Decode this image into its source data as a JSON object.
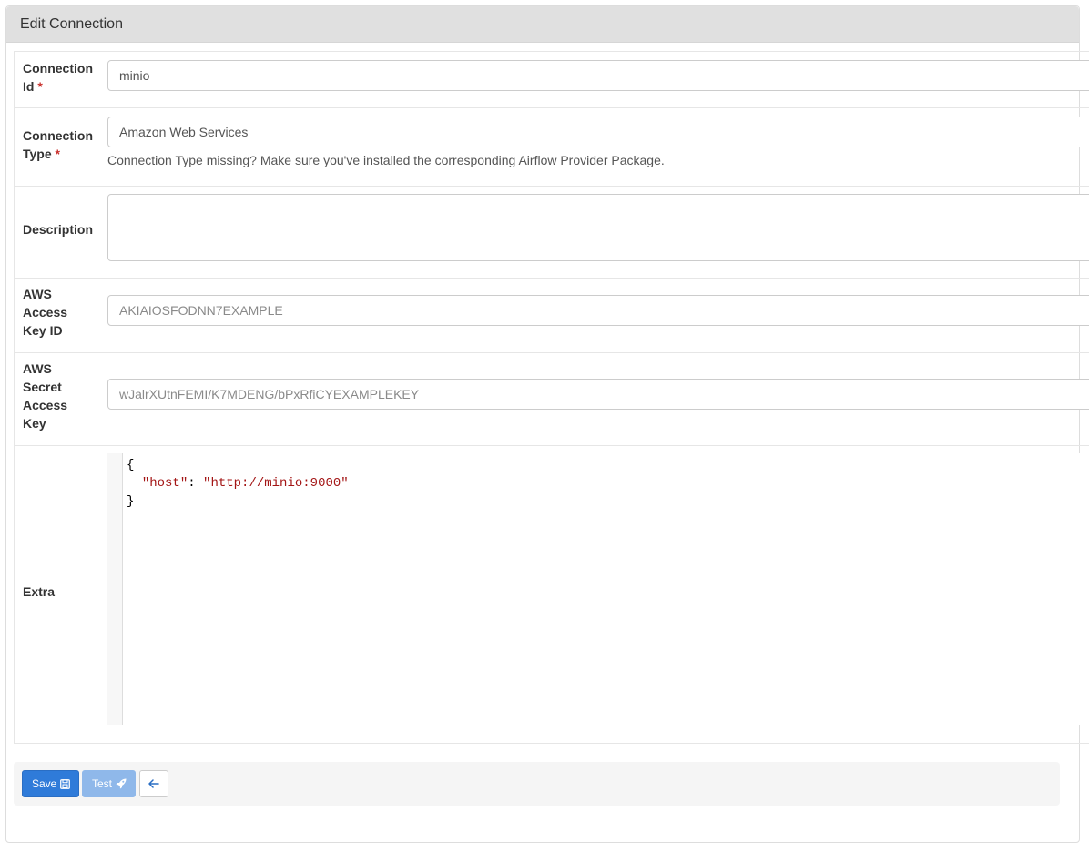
{
  "panel": {
    "title": "Edit Connection"
  },
  "fields": {
    "conn_id": {
      "label_line1": "Connection",
      "label_line2": "Id",
      "required_mark": "*",
      "value": "minio"
    },
    "conn_type": {
      "label_line1": "Connection",
      "label_line2": "Type",
      "required_mark": "*",
      "value": "Amazon Web Services",
      "help": "Connection Type missing? Make sure you've installed the corresponding Airflow Provider Package."
    },
    "description": {
      "label": "Description",
      "value": ""
    },
    "aws_access_key_id": {
      "label_line1": "AWS",
      "label_line2": "Access",
      "label_line3": "Key ID",
      "placeholder": "AKIAIOSFODNN7EXAMPLE"
    },
    "aws_secret_access_key": {
      "label_line1": "AWS",
      "label_line2": "Secret",
      "label_line3": "Access",
      "label_line4": "Key",
      "placeholder": "wJalrXUtnFEMI/K7MDENG/bPxRfiCYEXAMPLEKEY"
    },
    "extra": {
      "label": "Extra",
      "line1": "{",
      "key": "\"host\"",
      "sep": ": ",
      "value": "\"http://minio:9000\"",
      "line3": "}"
    }
  },
  "actions": {
    "save_label": "Save",
    "test_label": "Test"
  },
  "icons": {
    "save": "floppy-disk-icon",
    "test": "rocket-icon",
    "back": "arrow-left-icon"
  },
  "colors": {
    "primary": "#2f7bd9",
    "primary_disabled": "#8fb8ea",
    "required": "#c9302c",
    "heading_bg": "#e0e0e0"
  }
}
